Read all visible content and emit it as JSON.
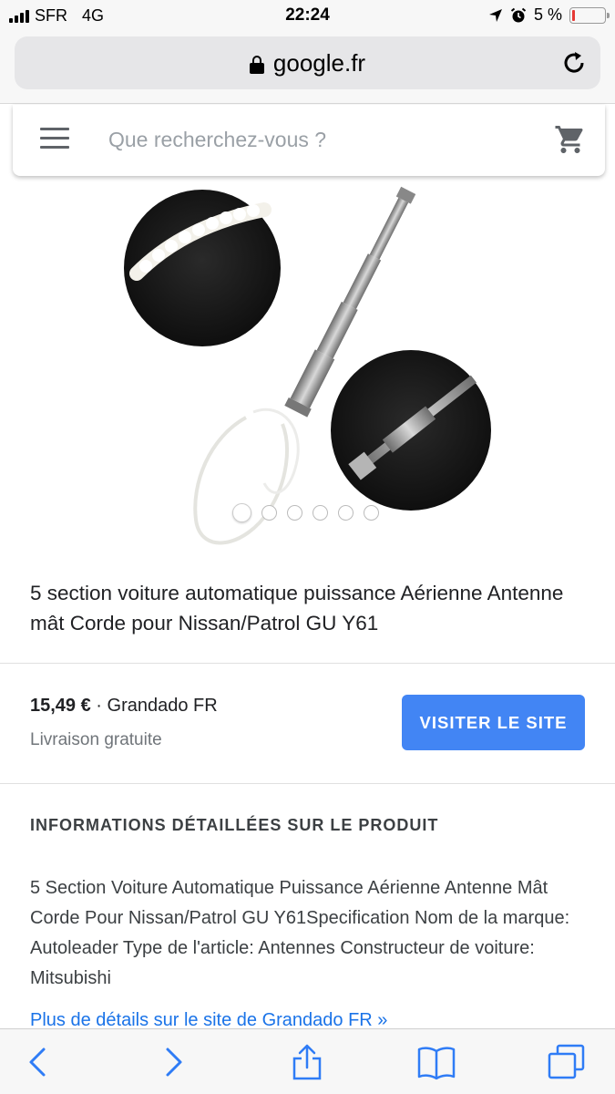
{
  "status_bar": {
    "carrier": "SFR",
    "network": "4G",
    "time": "22:24",
    "battery_text": "5 %",
    "battery_level": 0.05,
    "icons": [
      "signal-icon",
      "location-arrow-icon",
      "alarm-icon",
      "battery-icon"
    ]
  },
  "browser": {
    "url": "google.fr",
    "icons": [
      "lock-icon",
      "reload-icon"
    ]
  },
  "search": {
    "placeholder": "Que recherchez-vous ?",
    "icons": [
      "menu-icon",
      "cart-icon"
    ]
  },
  "product": {
    "title": "5 section voiture automatique puissance Aérienne Antenne mât Corde pour Nissan/Patrol GU Y61",
    "carousel": {
      "count": 6,
      "active_index": 0
    },
    "price": "15,49 €",
    "price_separator": " · ",
    "seller": "Grandado FR",
    "shipping": "Livraison gratuite",
    "visit_label": "VISITER LE SITE"
  },
  "details": {
    "heading": "INFORMATIONS DÉTAILLÉES SUR LE PRODUIT",
    "description": "5 Section Voiture Automatique Puissance Aérienne Antenne Mât Corde Pour Nissan/Patrol GU Y61Specification Nom de la marque: Autoleader Type de l'article: Antennes Constructeur de voiture: Mitsubishi",
    "more_link": "Plus de détails sur le site de Grandado FR »"
  },
  "toolbar": {
    "items": [
      "back-icon",
      "forward-icon",
      "share-icon",
      "bookmarks-icon",
      "tabs-icon"
    ],
    "accent": "#2f7cf6"
  },
  "colors": {
    "accent": "#4285f4",
    "link": "#1a73e8",
    "battery_low": "#e53935"
  }
}
